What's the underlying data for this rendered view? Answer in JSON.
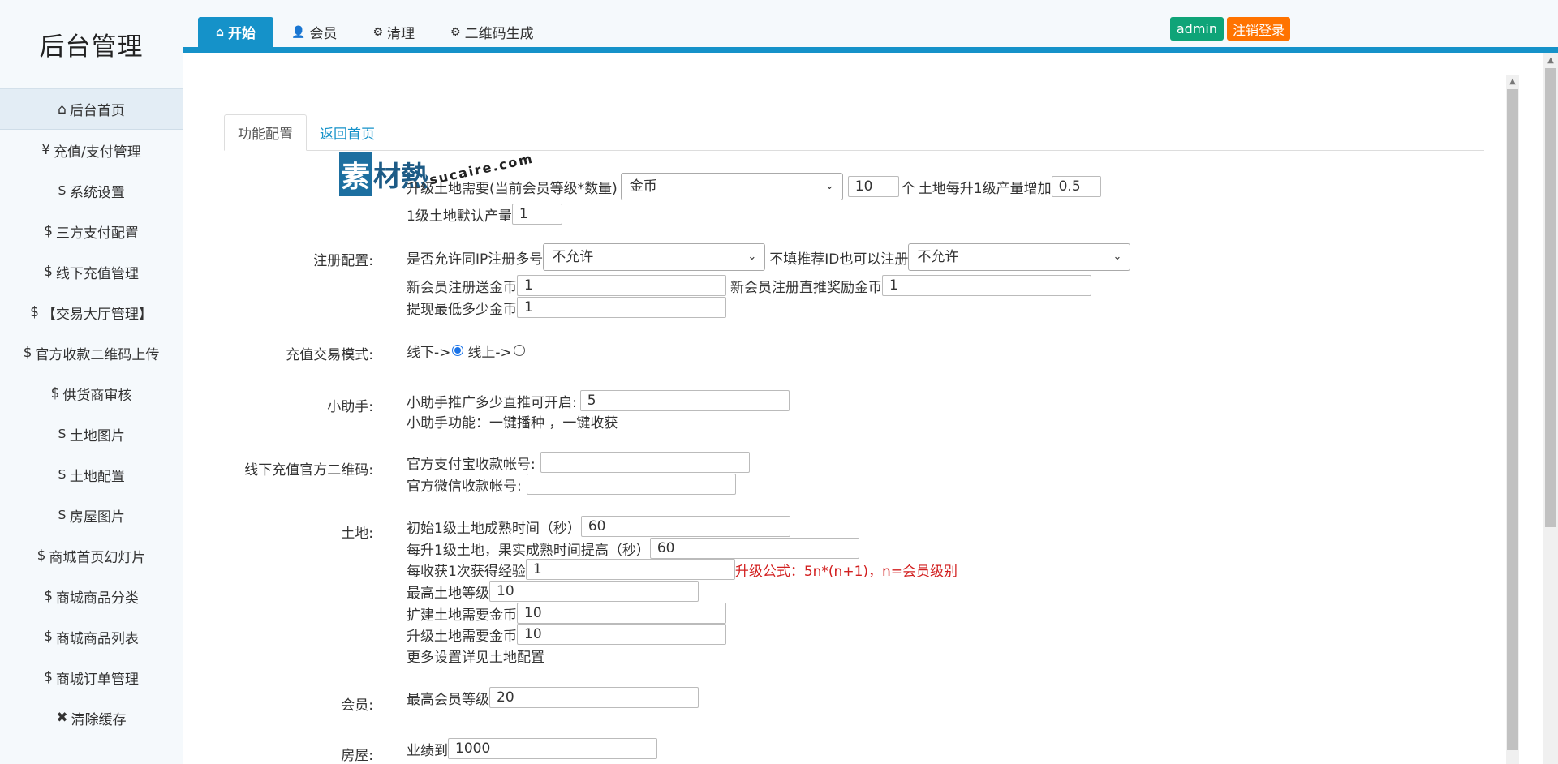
{
  "sidebar": {
    "logo": "后台管理",
    "items": [
      {
        "icon": "home-icon",
        "glyph": "⌂",
        "label": "后台首页"
      },
      {
        "icon": "yen-icon",
        "glyph": "¥",
        "label": "充值/支付管理"
      },
      {
        "icon": "dollar-icon",
        "glyph": "$",
        "label": "系统设置"
      },
      {
        "icon": "dollar-icon",
        "glyph": "$",
        "label": "三方支付配置"
      },
      {
        "icon": "dollar-icon",
        "glyph": "$",
        "label": "线下充值管理"
      },
      {
        "icon": "dollar-icon",
        "glyph": "$",
        "label": "【交易大厅管理】"
      },
      {
        "icon": "dollar-icon",
        "glyph": "$",
        "label": "官方收款二维码上传"
      },
      {
        "icon": "dollar-icon",
        "glyph": "$",
        "label": "供货商审核"
      },
      {
        "icon": "dollar-icon",
        "glyph": "$",
        "label": "土地图片"
      },
      {
        "icon": "dollar-icon",
        "glyph": "$",
        "label": "土地配置"
      },
      {
        "icon": "dollar-icon",
        "glyph": "$",
        "label": "房屋图片"
      },
      {
        "icon": "dollar-icon",
        "glyph": "$",
        "label": "商城首页幻灯片"
      },
      {
        "icon": "dollar-icon",
        "glyph": "$",
        "label": "商城商品分类"
      },
      {
        "icon": "dollar-icon",
        "glyph": "$",
        "label": "商城商品列表"
      },
      {
        "icon": "dollar-icon",
        "glyph": "$",
        "label": "商城订单管理"
      },
      {
        "icon": "close-icon",
        "glyph": "✖",
        "label": "清除缓存"
      }
    ]
  },
  "topbar": {
    "tabs": [
      {
        "icon": "home-icon",
        "glyph": "⌂",
        "label": "开始"
      },
      {
        "icon": "user-icon",
        "glyph": "👤",
        "label": "会员"
      },
      {
        "icon": "gears-icon",
        "glyph": "⚙",
        "label": "清理"
      },
      {
        "icon": "gears-icon",
        "glyph": "⚙",
        "label": "二维码生成"
      }
    ],
    "user": "admin",
    "logout": "注销登录"
  },
  "inner_tabs": [
    "功能配置",
    "返回首页"
  ],
  "watermark": {
    "box": "素",
    "main": "材熱",
    "sub": "sucaire.com"
  },
  "form": {
    "upgrade": {
      "label": "升级土地需要(当前会员等级*数量)",
      "currency": "金币",
      "qty": "10",
      "unit": "个",
      "increase_label": "土地每升1级产量增加",
      "increase": "0.5",
      "default_label": "1级土地默认产量",
      "default": "1"
    },
    "register": {
      "label": "注册配置:",
      "same_ip_label": "是否允许同IP注册多号",
      "same_ip": "不允许",
      "no_ref_label": "不填推荐ID也可以注册",
      "no_ref": "不允许",
      "bonus_label": "新会员注册送金币",
      "bonus": "1",
      "ref_bonus_label": "新会员注册直推奖励金币",
      "ref_bonus": "1",
      "withdraw_label": "提现最低多少金币",
      "withdraw": "1"
    },
    "recharge_mode": {
      "label": "充值交易模式:",
      "offline": "线下->",
      "online": "线上->"
    },
    "helper": {
      "label": "小助手:",
      "promo_label": "小助手推广多少直推可开启:",
      "promo": "5",
      "desc": "小助手功能：一键播种 ，一键收获"
    },
    "qrcode": {
      "label": "线下充值官方二维码:",
      "alipay_label": "官方支付宝收款帐号:",
      "alipay": "",
      "wechat_label": "官方微信收款帐号:",
      "wechat": ""
    },
    "land": {
      "label": "土地:",
      "init_time_label": "初始1级土地成熟时间（秒）",
      "init_time": "60",
      "per_level_label": "每升1级土地，果实成熟时间提高（秒）",
      "per_level": "60",
      "exp_label": "每收获1次获得经验",
      "exp": "1",
      "formula": "升级公式：5n*(n+1)，n=会员级别",
      "max_level_label": "最高土地等级",
      "max_level": "10",
      "expand_label": "扩建土地需要金币",
      "expand": "10",
      "upgrade_cost_label": "升级土地需要金币",
      "upgrade_cost": "10",
      "more": "更多设置详见土地配置"
    },
    "member": {
      "label": "会员:",
      "max_level_label": "最高会员等级",
      "max_level": "20"
    },
    "house": {
      "label": "房屋:",
      "perf_label": "业绩到",
      "perf": "1000"
    }
  }
}
